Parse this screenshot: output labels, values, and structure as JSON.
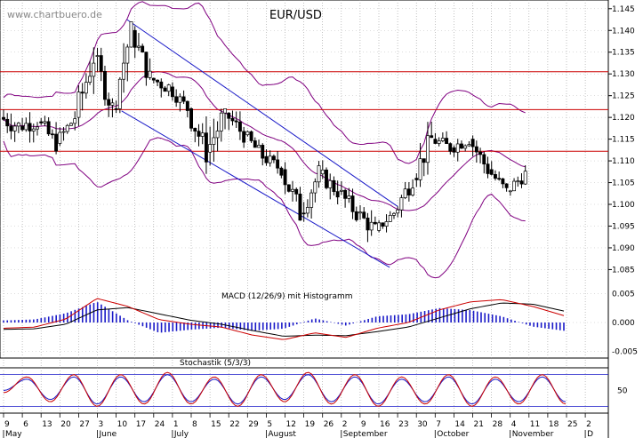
{
  "watermark": "www.chartbuero.de",
  "chart_data": [
    {
      "type": "candlestick",
      "title": "EUR/USD",
      "ylim": [
        1.081,
        1.147
      ],
      "y_ticks": [
        "1.145",
        "1.140",
        "1.135",
        "1.130",
        "1.125",
        "1.120",
        "1.115",
        "1.110",
        "1.105",
        "1.100",
        "1.095",
        "1.090",
        "1.085"
      ],
      "horizontal_lines": [
        1.1305,
        1.1218,
        1.1122
      ],
      "trend_channel": [
        {
          "from": [
            "24 Jun",
            1.1425
          ],
          "to": [
            "3 Oct",
            1.0995
          ]
        },
        {
          "from": [
            "22 Jun",
            1.1215
          ],
          "to": [
            "30 Sep",
            1.0855
          ]
        }
      ],
      "bollinger": true,
      "colors": {
        "candles": "#000000",
        "resistance": "#cc0000",
        "channel": "#1a1ac8",
        "bands": "#800080",
        "background": "#ffffff",
        "grid": "#888888"
      },
      "ohlc_approx": [
        [
          "9 May",
          1.12,
          1.125,
          1.112,
          1.118
        ],
        [
          "16 May",
          1.118,
          1.124,
          1.113,
          1.119
        ],
        [
          "23 May",
          1.119,
          1.122,
          1.11,
          1.114
        ],
        [
          "30 May",
          1.114,
          1.122,
          1.112,
          1.12
        ],
        [
          "6 Jun",
          1.12,
          1.137,
          1.118,
          1.134
        ],
        [
          "13 Jun",
          1.134,
          1.136,
          1.12,
          1.122
        ],
        [
          "20 Jun",
          1.122,
          1.142,
          1.121,
          1.14
        ],
        [
          "27 Jun",
          1.14,
          1.141,
          1.127,
          1.129
        ],
        [
          "4 Jul",
          1.129,
          1.131,
          1.12,
          1.127
        ],
        [
          "11 Jul",
          1.127,
          1.129,
          1.12,
          1.122
        ],
        [
          "18 Jul",
          1.122,
          1.124,
          1.107,
          1.112
        ],
        [
          "25 Jul",
          1.112,
          1.122,
          1.104,
          1.121
        ],
        [
          "1 Aug",
          1.121,
          1.123,
          1.112,
          1.116
        ],
        [
          "8 Aug",
          1.116,
          1.117,
          1.107,
          1.111
        ],
        [
          "15 Aug",
          1.111,
          1.115,
          1.106,
          1.108
        ],
        [
          "22 Aug",
          1.108,
          1.11,
          1.093,
          1.098
        ],
        [
          "29 Aug",
          1.098,
          1.11,
          1.096,
          1.107
        ],
        [
          "5 Sep",
          1.107,
          1.111,
          1.1,
          1.103
        ],
        [
          "12 Sep",
          1.103,
          1.108,
          1.096,
          1.098
        ],
        [
          "19 Sep",
          1.098,
          1.1,
          1.088,
          1.094
        ],
        [
          "26 Sep",
          1.094,
          1.1,
          1.093,
          1.098
        ],
        [
          "3 Oct",
          1.098,
          1.11,
          1.097,
          1.106
        ],
        [
          "10 Oct",
          1.106,
          1.119,
          1.104,
          1.115
        ],
        [
          "17 Oct",
          1.115,
          1.118,
          1.109,
          1.113
        ],
        [
          "24 Oct",
          1.113,
          1.118,
          1.109,
          1.115
        ],
        [
          "31 Oct",
          1.115,
          1.117,
          1.106,
          1.108
        ],
        [
          "7 Nov",
          1.108,
          1.11,
          1.101,
          1.103
        ],
        [
          "14 Nov",
          1.103,
          1.109,
          1.1,
          1.107
        ]
      ]
    },
    {
      "type": "line",
      "title": "MACD (12/26/9) mit Histogramm",
      "ylim": [
        -0.0062,
        0.0062
      ],
      "y_ticks": [
        "0.005",
        "0.000",
        "-0.005"
      ],
      "series": [
        {
          "values": [
            -0.001,
            -0.0008,
            0.0006,
            0.0042,
            0.0028,
            0.0005,
            -0.0003,
            -0.0008,
            -0.0022,
            -0.003,
            -0.0018,
            -0.0026,
            -0.001,
            0.0,
            0.0022,
            0.0036,
            0.004,
            0.0028,
            0.0012
          ]
        },
        {
          "values": [
            -0.0012,
            -0.0011,
            -0.0003,
            0.0022,
            0.0026,
            0.0015,
            0.0004,
            -0.0003,
            -0.0014,
            -0.0024,
            -0.0022,
            -0.0023,
            -0.0016,
            -0.0008,
            0.0008,
            0.0024,
            0.0034,
            0.0032,
            0.002
          ]
        }
      ],
      "x": [
        "9 May",
        "23 May",
        "6 Jun",
        "27 Jun",
        "11 Jul",
        "25 Jul",
        "8 Aug",
        "22 Aug",
        "5 Sep",
        "19 Sep",
        "26 Sep",
        "3 Oct",
        "10 Oct",
        "17 Oct",
        "24 Oct",
        "31 Oct",
        "7 Nov",
        "11 Nov",
        "16 Nov"
      ],
      "colors": {
        "macd": "#cc0000",
        "signal": "#000000",
        "histogram": "#1a1ac8"
      }
    },
    {
      "type": "line",
      "title": "Stochastik (5/3/3)",
      "ylim": [
        0,
        100
      ],
      "y_ticks": [
        "50"
      ],
      "reference_lines": [
        85,
        15
      ],
      "series": [
        {
          "values": [
            45,
            80,
            25,
            85,
            15,
            85,
            20,
            90,
            20,
            80,
            15,
            85,
            25,
            90,
            20,
            85,
            15,
            80,
            20,
            85,
            15,
            80,
            20,
            85,
            20
          ]
        },
        {
          "values": [
            50,
            75,
            30,
            80,
            20,
            80,
            25,
            85,
            25,
            75,
            20,
            80,
            30,
            85,
            25,
            80,
            20,
            75,
            25,
            80,
            20,
            75,
            25,
            80,
            25
          ]
        }
      ],
      "colors": {
        "k": "#cc0000",
        "d": "#1a1ac8"
      }
    }
  ],
  "x_axis": {
    "day_labels": [
      "9",
      "6",
      "13",
      "20",
      "27",
      "3",
      "10",
      "17",
      "24",
      "1",
      "8",
      "15",
      "22",
      "29",
      "5",
      "12",
      "19",
      "26",
      "2",
      "9",
      "16",
      "23",
      "30",
      "7",
      "14",
      "21",
      "28",
      "4",
      "11",
      "18",
      "25",
      "2"
    ],
    "month_labels": [
      "May",
      "June",
      "July",
      "August",
      "September",
      "October",
      "November",
      "D"
    ]
  }
}
